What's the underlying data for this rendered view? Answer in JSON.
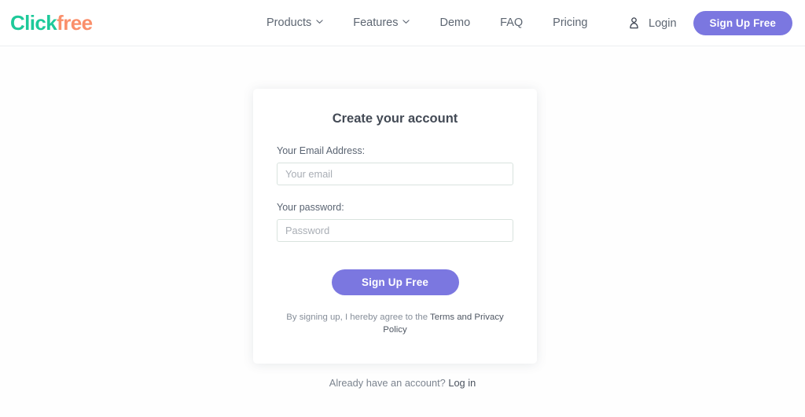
{
  "brand": {
    "part1": "Click",
    "part2": "free",
    "color1": "#1ec99a",
    "color2": "#fa8f6b"
  },
  "header": {
    "nav": [
      {
        "label": "Products",
        "has_caret": true
      },
      {
        "label": "Features",
        "has_caret": true
      },
      {
        "label": "Demo",
        "has_caret": false
      },
      {
        "label": "FAQ",
        "has_caret": false
      },
      {
        "label": "Pricing",
        "has_caret": false
      }
    ],
    "user_icon": "user-icon",
    "login_label": "Login",
    "signup_label": "Sign Up Free",
    "accent_color": "#7b77e0"
  },
  "card": {
    "title": "Create your account",
    "email": {
      "label": "Your Email Address:",
      "placeholder": "Your email",
      "value": ""
    },
    "password": {
      "label": "Your password:",
      "placeholder": "Password",
      "value": ""
    },
    "submit_label": "Sign Up Free",
    "terms": {
      "prefix": "By signing up, I hereby agree to the ",
      "link": "Terms and Privacy Policy"
    }
  },
  "footer": {
    "prompt": "Already have an account? ",
    "login_link": "Log in"
  }
}
